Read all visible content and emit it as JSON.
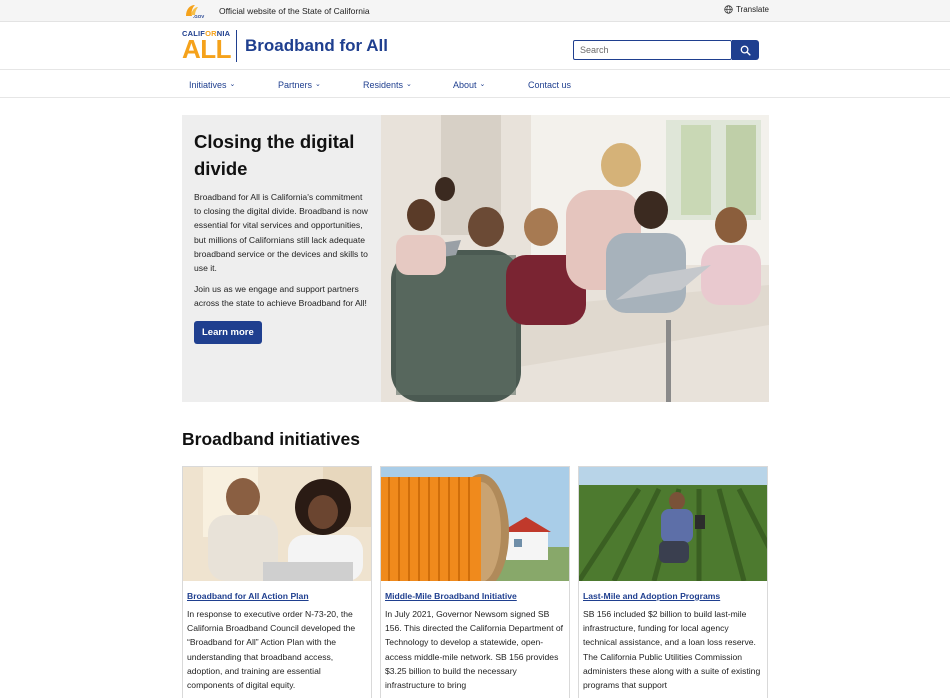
{
  "util_bar": {
    "logo_text": ".GOV",
    "official_text": "Official website of the State of California",
    "translate_label": "Translate"
  },
  "header": {
    "logo_california_left": "CALIF",
    "logo_california_mid": "OR",
    "logo_california_right": "NIA",
    "logo_all": "ALL",
    "site_title": "Broadband for All",
    "search_placeholder": "Search"
  },
  "nav": {
    "items": [
      {
        "label": "Initiatives",
        "has_dropdown": true
      },
      {
        "label": "Partners",
        "has_dropdown": true
      },
      {
        "label": "Residents",
        "has_dropdown": true
      },
      {
        "label": "About",
        "has_dropdown": true
      },
      {
        "label": "Contact us",
        "has_dropdown": false
      }
    ]
  },
  "hero": {
    "title": "Closing the digital divide",
    "paragraph1": "Broadband for All is California's commitment to closing the digital divide. Broadband is now essential for vital services and opportunities, but millions of Californians still lack adequate broadband service or the devices and skills to use it.",
    "paragraph2": "Join us as we engage and support partners across the state to achieve Broadband for All!",
    "button_label": "Learn more"
  },
  "initiatives": {
    "title": "Broadband initiatives",
    "cards": [
      {
        "link": "Broadband for All Action Plan",
        "text": "In response to executive order N-73-20, the California Broadband Council developed the “Broadband for All” Action Plan with the understanding that broadband access, adoption, and training are essential components of digital equity."
      },
      {
        "link": "Middle-Mile Broadband Initiative",
        "text": "In July 2021, Governor Newsom signed SB 156. This directed the California Department of Technology to develop a statewide, open-access middle-mile network. SB 156 provides $3.25 billion to build the necessary infrastructure to bring"
      },
      {
        "link": "Last-Mile and Adoption Programs",
        "text": "SB 156 included $2 billion to build last-mile infrastructure, funding for local agency technical assistance, and a loan loss reserve. The California Public Utilities Commission administers these along with a suite of existing programs that support"
      }
    ]
  },
  "colors": {
    "brand_blue": "#1f3f8f",
    "brand_orange": "#f5a21b",
    "hero_panel": "#eeeeee"
  },
  "icons": [
    "ca-gov-logo-icon",
    "globe-icon",
    "search-icon",
    "chevron-down-icon"
  ]
}
